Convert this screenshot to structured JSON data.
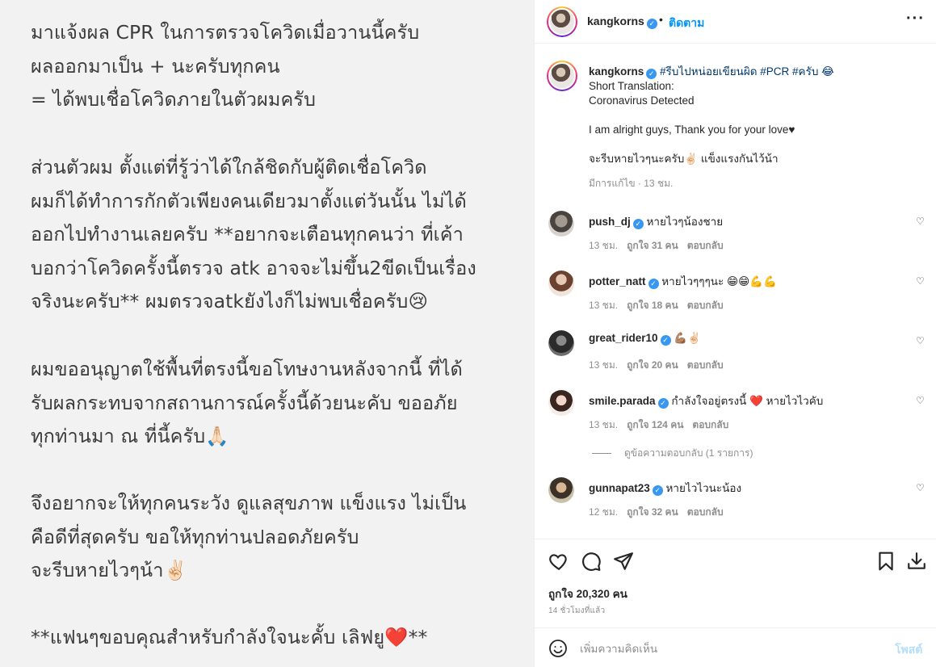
{
  "post_image": {
    "paragraphs": [
      [
        "มาแจ้งผล CPR ในการตรวจโควิดเมื่อวานนี้ครับ",
        "ผลออกมาเป็น + นะครับทุกคน",
        "= ได้พบเชื่อโควิดภายในตัวผมครับ"
      ],
      [
        "ส่วนตัวผม ตั้งแต่ที่รู้ว่าได้ใกล้ชิดกับผู้ติดเชื่อโควิด",
        "ผมก็ได้ทำการกักตัวเพียงคนเดียวมาตั้งแต่วันนั้น ไม่ได้",
        "ออกไปทำงานเลยครับ **อยากจะเตือนทุกคนว่า ที่เค้า",
        "บอกว่าโควิดครั้งนี้ตรวจ atk อาจจะไม่ขึ้น2ขีดเป็นเรื่อง",
        "จริงนะครับ** ผมตรวจatkยังไงก็ไม่พบเชื่อครับ😢"
      ],
      [
        "ผมขออนุญาตใช้พื้นที่ตรงนี้ขอโทษงานหลังจากนี้ ที่ได้",
        "รับผลกระทบจากสถานการณ์ครั้งนี้ด้วยนะคับ ขออภัย",
        "ทุกท่านมา ณ ที่นี้ครับ🙏🏻"
      ],
      [
        "จึงอยากจะให้ทุกคนระวัง ดูแลสุขภาพ แข็งแรง ไม่เป็น",
        "คือดีที่สุดครับ ขอให้ทุกท่านปลอดภัยครับ",
        "จะรีบหายไวๆน้า✌🏻"
      ],
      [
        "**แฟนๆขอบคุณสำหรับกำลังใจนะคั้บ เลิฟยู❤️**"
      ]
    ]
  },
  "header": {
    "username": "kangkorns",
    "dot": "•",
    "follow_label": "ติดตาม",
    "more_icon": "more-horizontal-icon"
  },
  "caption": {
    "username": "kangkorns",
    "hashtags": "#รีบไปหน่อยเขียนผิด #PCR #ครับ 😂",
    "lines": [
      "Short Translation:",
      "Coronavirus Detected",
      "",
      "I am alright guys, Thank you for your love♥",
      "",
      "จะรีบหายไวๆนะครับ✌🏻 แข็งแรงกันไว้น้า"
    ],
    "meta": "มีการแก้ไข · 13 ชม."
  },
  "comments": [
    {
      "username": "push_dj",
      "text": "หายไวๆน้องชาย",
      "time": "13 ชม.",
      "likes": "ถูกใจ 31 คน",
      "reply": "ตอบกลับ"
    },
    {
      "username": "potter_natt",
      "text": "หายไวๆๆๆนะ 😁😁💪💪",
      "time": "13 ชม.",
      "likes": "ถูกใจ 18 คน",
      "reply": "ตอบกลับ"
    },
    {
      "username": "great_rider10",
      "text": "💪🏽✌🏻",
      "time": "13 ชม.",
      "likes": "ถูกใจ 20 คน",
      "reply": "ตอบกลับ"
    },
    {
      "username": "smile.parada",
      "text": "กำลังใจอยู่ตรงนี้ ❤️ หายไวไวคับ",
      "time": "13 ชม.",
      "likes": "ถูกใจ 124 คน",
      "reply": "ตอบกลับ"
    },
    {
      "username": "gunnapat23",
      "text": "หายไวไวนะน้อง",
      "time": "12 ชม.",
      "likes": "ถูกใจ 32 คน",
      "reply": "ตอบกลับ"
    }
  ],
  "view_replies": "ดูข้อความตอบกลับ (1 รายการ)",
  "actions": {
    "icons": [
      "heart-icon",
      "comment-icon",
      "share-icon",
      "save-icon",
      "download-icon"
    ],
    "likes": "ถูกใจ 20,320 คน",
    "time_ago": "14 ชั่วโมงที่แล้ว"
  },
  "add_comment": {
    "placeholder": "เพิ่มความคิดเห็น",
    "post_label": "โพสต์"
  },
  "colors": {
    "accent": "#0095f6",
    "verified": "#3897f0",
    "hashtag": "#00376b",
    "muted": "#8e8e8e",
    "post_bg": "#f2f2f2"
  }
}
